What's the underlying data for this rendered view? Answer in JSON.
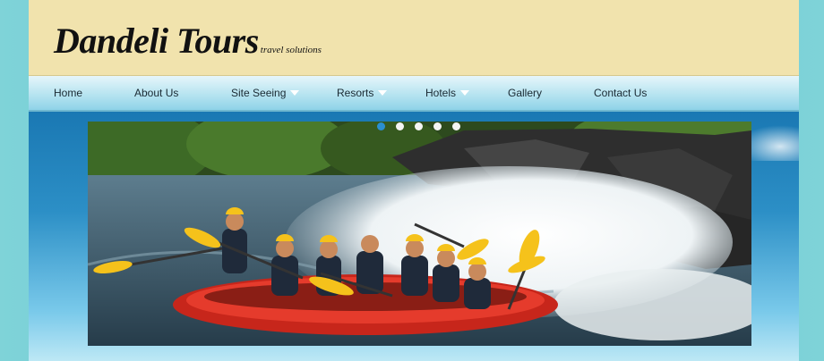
{
  "site": {
    "logo_text": "Dandeli Tours",
    "tagline": "travel solutions"
  },
  "nav": {
    "items": [
      {
        "label": "Home",
        "has_dropdown": false
      },
      {
        "label": "About Us",
        "has_dropdown": false
      },
      {
        "label": "Site Seeing",
        "has_dropdown": true
      },
      {
        "label": "Resorts",
        "has_dropdown": true
      },
      {
        "label": "Hotels",
        "has_dropdown": true
      },
      {
        "label": "Gallery",
        "has_dropdown": false
      },
      {
        "label": "Contact Us",
        "has_dropdown": false
      }
    ]
  },
  "slider": {
    "image_subject": "River rafting group in red raft",
    "slide_count": 5,
    "active_slide": 1
  },
  "colors": {
    "header_bg": "#f1e3ad",
    "nav_gradient_top": "#e6f6fb",
    "nav_gradient_bottom": "#8fd3e8",
    "page_bg": "#5ec7cf",
    "active_dot": "#2b8fd0",
    "raft": "#e53b2c",
    "paddle": "#f5c21b"
  }
}
